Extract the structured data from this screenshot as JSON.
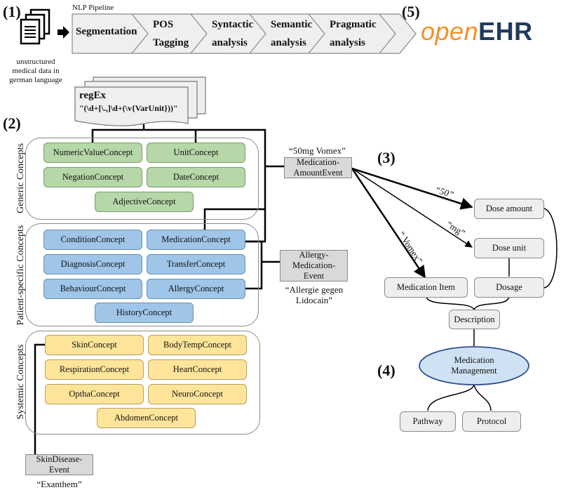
{
  "sections": {
    "s1": "(1)",
    "s2": "(2)",
    "s3": "(3)",
    "s4": "(4)",
    "s5": "(5)"
  },
  "input": {
    "icon": "documents-icon",
    "caption_lines": [
      "unstructured",
      "medical data in",
      "german language"
    ]
  },
  "pipeline": {
    "title": "NLP Pipeline",
    "steps": [
      {
        "line1": "Segmentation",
        "line2": ""
      },
      {
        "line1": "POS",
        "line2": "Tagging"
      },
      {
        "line1": "Syntactic",
        "line2": "analysis"
      },
      {
        "line1": "Semantic",
        "line2": "analysis"
      },
      {
        "line1": "Pragmatic",
        "line2": "analysis"
      }
    ]
  },
  "logo": {
    "part1": "open",
    "part2": "EHR",
    "color1": "#f0922b",
    "color2": "#1f3a5f"
  },
  "regex": {
    "title": "regEx",
    "pattern": "\"(\\d+[\\.,]\\d+(\\v{VarUnit}))\""
  },
  "groups": {
    "generic": {
      "label": "Generic Concepts",
      "color": "#b6d7a8",
      "items": [
        "NumericValueConcept",
        "UnitConcept",
        "NegationConcept",
        "DateConcept",
        "AdjectiveConcept"
      ]
    },
    "patient": {
      "label": "Patient-specific Concepts",
      "color": "#9fc5e8",
      "items": [
        "ConditionConcept",
        "MedicationConcept",
        "DiagnosisConcept",
        "TransferConcept",
        "BehaviourConcept",
        "AllergyConcept",
        "HistoryConcept"
      ]
    },
    "systemic": {
      "label": "Systemic Concepts",
      "color": "#ffe599",
      "items": [
        "SkinConcept",
        "BodyTempConcept",
        "RespirationConcept",
        "HeartConcept",
        "OpthaConcept",
        "NeuroConcept",
        "AbdomenConcept"
      ]
    }
  },
  "events": {
    "medication_amount": {
      "lines": [
        "Medication-",
        "AmountEvent"
      ],
      "example": "“50mg  Vomex”"
    },
    "allergy_medication": {
      "lines": [
        "Allergy-",
        "Medication-",
        "Event"
      ],
      "example_lines": [
        "“Allergie gegen",
        "Lidocain”"
      ]
    },
    "skin_disease": {
      "lines": [
        "SkinDisease-",
        "Event"
      ],
      "example": "“Exanthem”"
    }
  },
  "openehr_model": {
    "edge_labels": {
      "dose_amount": "“50”",
      "dose_unit": "“mg”",
      "medication_item": "“ Vomex”"
    },
    "nodes": {
      "dose_amount": "Dose amount",
      "dose_unit": "Dose unit",
      "medication_item": "Medication Item",
      "dosage": "Dosage",
      "description": "Description",
      "medication_management_lines": [
        "Medication",
        "Management"
      ],
      "pathway": "Pathway",
      "protocol": "Protocol"
    }
  }
}
